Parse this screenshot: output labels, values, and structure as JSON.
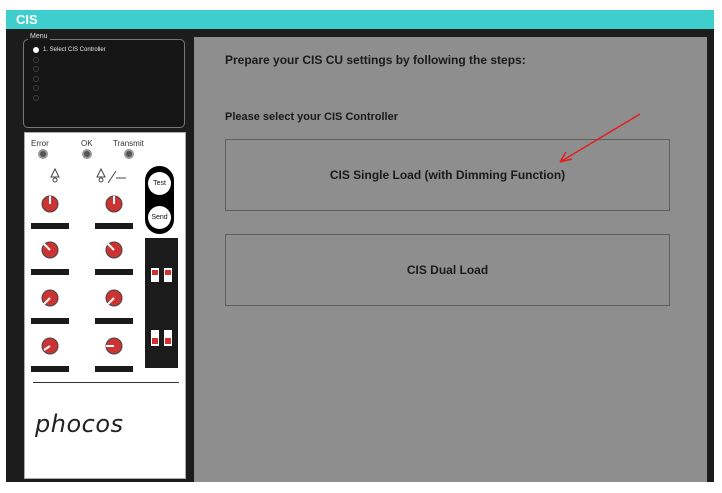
{
  "window": {
    "title": "CIS"
  },
  "menu": {
    "legend": "Menu",
    "items": [
      {
        "label": "1. Select CIS Controller",
        "selected": true
      },
      {
        "label": "",
        "selected": false
      },
      {
        "label": "",
        "selected": false
      },
      {
        "label": "",
        "selected": false
      },
      {
        "label": "",
        "selected": false
      },
      {
        "label": "",
        "selected": false
      }
    ]
  },
  "device": {
    "leds": [
      "Error",
      "OK",
      "Transmit"
    ],
    "buttons": {
      "test": "Test",
      "send": "Send"
    },
    "logo": "phocos"
  },
  "main": {
    "heading": "Prepare your CIS CU settings by following the steps:",
    "subheading": "Please select your CIS Controller",
    "options": [
      "CIS Single Load (with Dimming Function)",
      "CIS Dual Load"
    ]
  },
  "colors": {
    "titlebar": "#3ecece",
    "panel": "#8e8e8e",
    "frame": "#1c1c1c",
    "arrow": "#e02020"
  }
}
